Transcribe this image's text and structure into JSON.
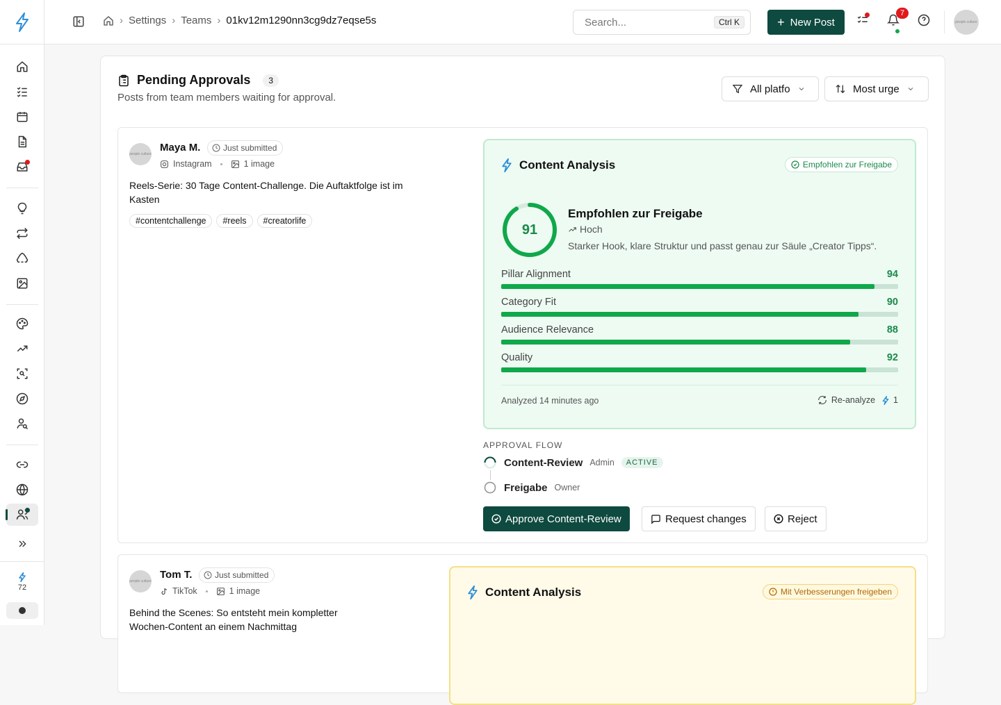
{
  "topbar": {
    "breadcrumb": [
      "Settings",
      "Teams",
      "01kv12m1290nn3cg9dz7eqse5s"
    ],
    "search_placeholder": "Search...",
    "search_shortcut": "Ctrl K",
    "new_post_label": "New Post",
    "notification_count": "7",
    "avatar_text": "people culture"
  },
  "sidebar": {
    "credits": "72",
    "items": [
      "home-icon",
      "tasks-icon",
      "calendar-icon",
      "document-icon",
      "inbox-icon",
      "lightbulb-icon",
      "repeat-icon",
      "recycle-icon",
      "image-icon",
      "palette-icon",
      "trending-icon",
      "scan-icon",
      "compass-icon",
      "user-search-icon",
      "link-icon",
      "globe-icon",
      "team-icon"
    ],
    "active_item": "team-icon"
  },
  "panel": {
    "title": "Pending Approvals",
    "count": "3",
    "subtitle": "Posts from team members waiting for approval.",
    "filter_platform": "All platfo",
    "sort": "Most urge"
  },
  "cards": [
    {
      "author": "Maya M.",
      "status": "Just submitted",
      "platform": "Instagram",
      "media": "1 image",
      "text": "Reels-Serie: 30 Tage Content-Challenge. Die Auftaktfolge ist im Kasten",
      "tags": [
        "#contentchallenge",
        "#reels",
        "#creatorlife"
      ],
      "analysis": {
        "title": "Content Analysis",
        "recommendation": "Empfohlen zur Freigabe",
        "score": 91,
        "verdict": "Empfohlen zur Freigabe",
        "level": "Hoch",
        "summary": "Starker Hook, klare Struktur und passt genau zur Säule „Creator Tipps“.",
        "metrics": [
          {
            "label": "Pillar Alignment",
            "value": 94
          },
          {
            "label": "Category Fit",
            "value": 90
          },
          {
            "label": "Audience Relevance",
            "value": 88
          },
          {
            "label": "Quality",
            "value": 92
          }
        ],
        "analyzed": "Analyzed 14 minutes ago",
        "reanalyze": "Re-analyze",
        "reanalyze_cost": "1"
      },
      "flow": {
        "label": "APPROVAL FLOW",
        "steps": [
          {
            "name": "Content-Review",
            "role": "Admin",
            "status": "ACTIVE"
          },
          {
            "name": "Freigabe",
            "role": "Owner"
          }
        ]
      },
      "actions": {
        "approve": "Approve Content-Review",
        "request": "Request changes",
        "reject": "Reject"
      }
    },
    {
      "author": "Tom T.",
      "status": "Just submitted",
      "platform": "TikTok",
      "media": "1 image",
      "text": "Behind the Scenes: So entsteht mein kompletter Wochen-Content an einem Nachmittag",
      "analysis": {
        "title": "Content Analysis",
        "recommendation": "Mit Verbesserungen freigeben"
      }
    }
  ],
  "colors": {
    "brand": "#0e4a3f",
    "success": "#0fa84a",
    "warning": "#b06a00",
    "alert": "#e0191d"
  }
}
